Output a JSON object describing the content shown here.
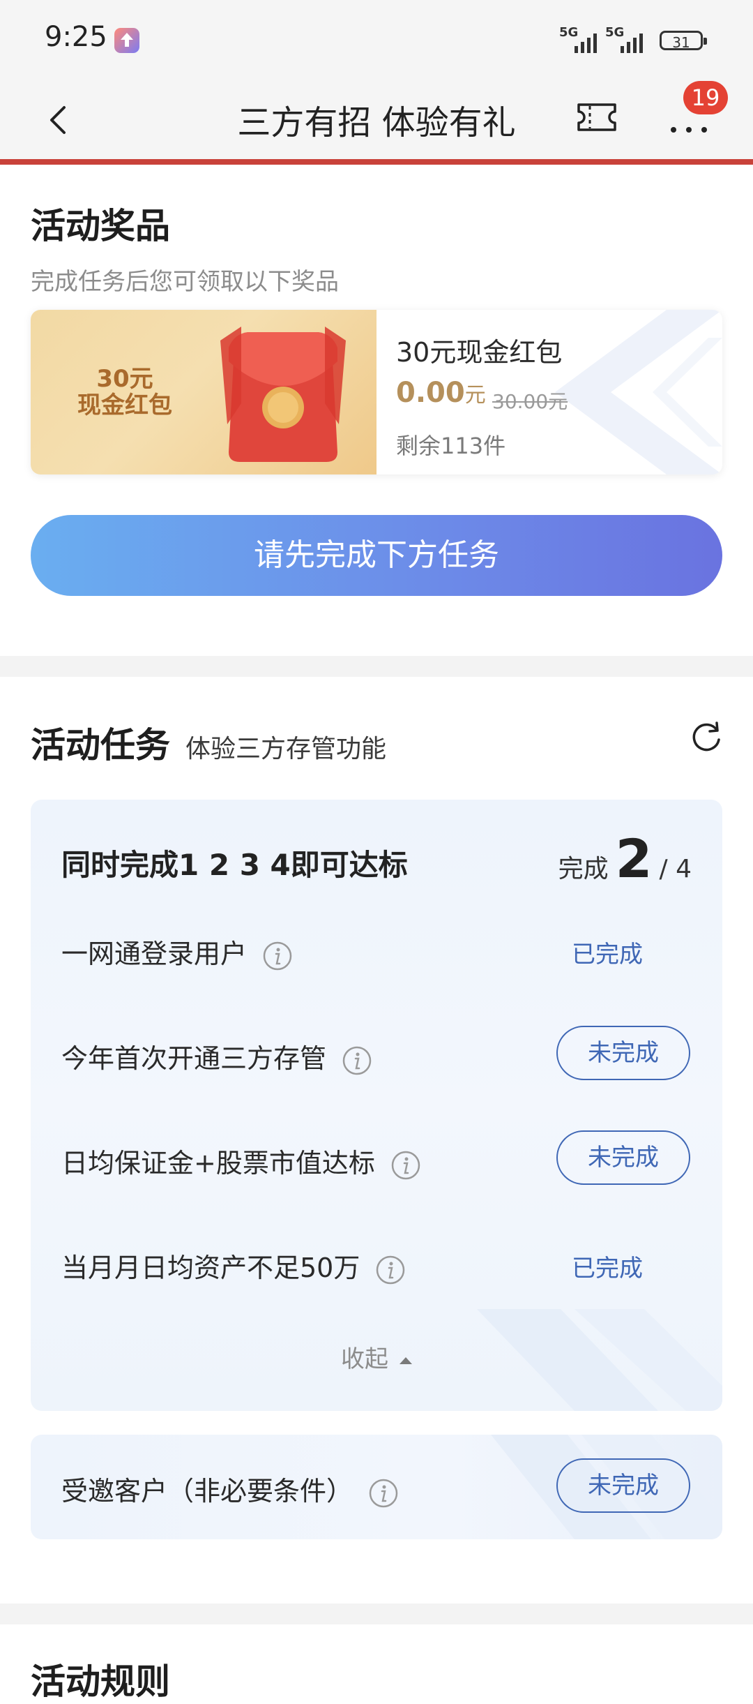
{
  "status_bar": {
    "time": "9:25",
    "network_1": "5G",
    "network_2": "5G",
    "battery": "31"
  },
  "nav": {
    "title": "三方有招 体验有礼",
    "notification_count": "19"
  },
  "prize_section": {
    "title": "活动奖品",
    "subtitle": "完成任务后您可领取以下奖品",
    "prize": {
      "image_text_line1": "30元",
      "image_text_line2": "现金红包",
      "name": "30元现金红包",
      "price": "0.00",
      "price_unit": "元",
      "original_price": "30.00元",
      "remaining": "剩余113件"
    },
    "action_button": "请先完成下方任务"
  },
  "task_section": {
    "title": "活动任务",
    "subtitle": "体验三方存管功能",
    "group_title": "同时完成1 2 3 4即可达标",
    "progress_label": "完成",
    "progress_done": "2",
    "progress_total": "/ 4",
    "tasks": [
      {
        "label": "一网通登录用户",
        "status": "已完成"
      },
      {
        "label": "今年首次开通三方存管",
        "status": "未完成"
      },
      {
        "label": "日均保证金+股票市值达标",
        "status": "未完成"
      },
      {
        "label": "当月月日均资产不足50万",
        "status": "已完成"
      }
    ],
    "collapse_label": "收起",
    "optional_task": {
      "label": "受邀客户（非必要条件）",
      "status": "未完成"
    }
  },
  "rules_section": {
    "title": "活动规则"
  },
  "colors": {
    "accent_red": "#c9423a",
    "link_blue": "#3f67b5",
    "gold": "#b5905b"
  }
}
